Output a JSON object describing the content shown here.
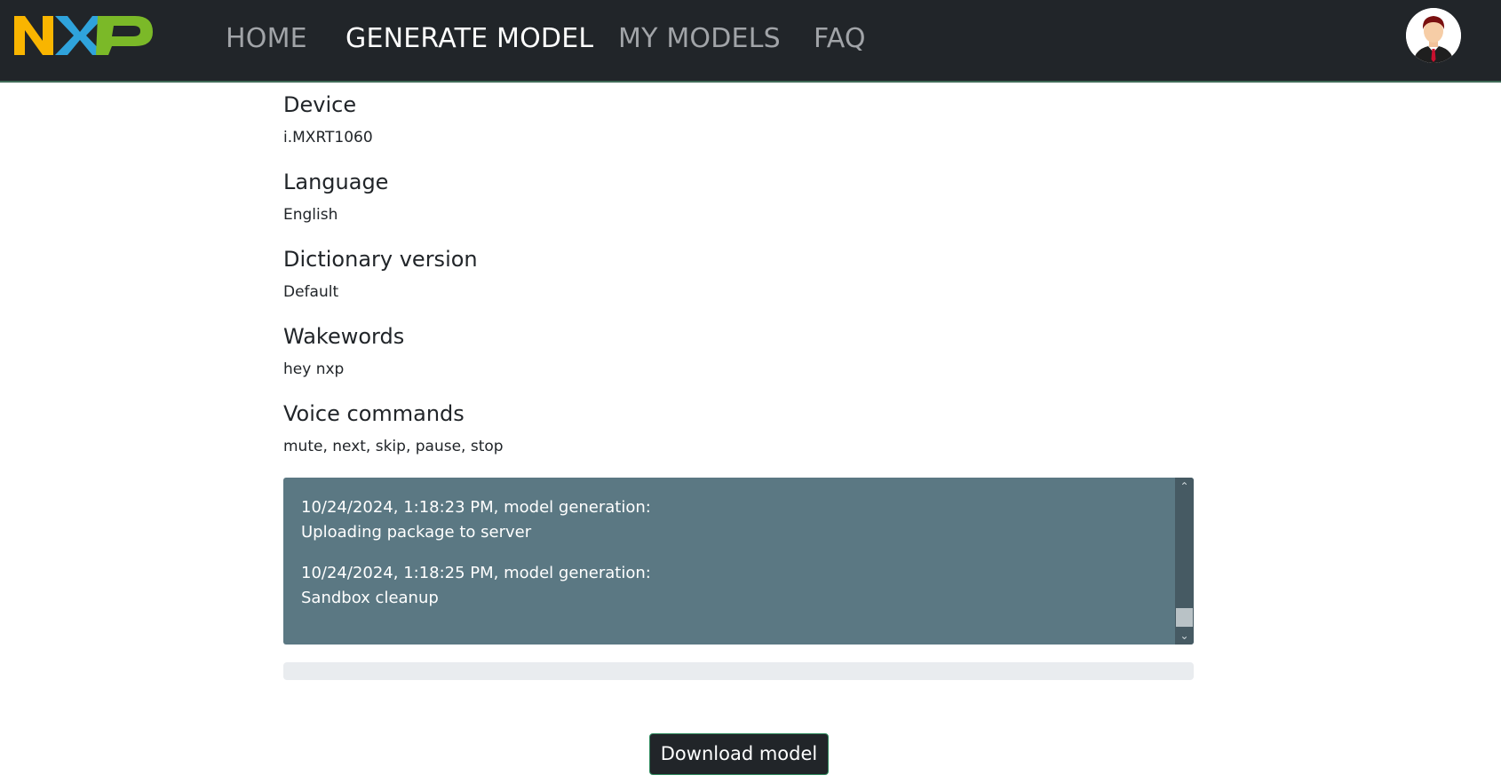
{
  "header": {
    "logo_text": "NXP",
    "nav": [
      {
        "label": "HOME"
      },
      {
        "label": "GENERATE MODEL"
      },
      {
        "label": "MY MODELS"
      },
      {
        "label": "FAQ"
      }
    ]
  },
  "fields": {
    "device": {
      "title": "Device",
      "value": "i.MXRT1060"
    },
    "language": {
      "title": "Language",
      "value": "English"
    },
    "dictionary": {
      "title": "Dictionary version",
      "value": "Default"
    },
    "wakewords": {
      "title": "Wakewords",
      "value": "hey nxp"
    },
    "voice_commands": {
      "title": "Voice commands",
      "value": "mute, next, skip, pause, stop"
    }
  },
  "log": {
    "entries": [
      {
        "timestamp": "10/24/2024, 1:18:23 PM, model generation:",
        "message": "Uploading package to server"
      },
      {
        "timestamp": "10/24/2024, 1:18:25 PM, model generation:",
        "message": "Sandbox cleanup"
      }
    ]
  },
  "progress": {
    "value": 0
  },
  "actions": {
    "download_label": "Download model"
  },
  "colors": {
    "navbar_bg": "#212529",
    "log_bg": "#5b7883",
    "logo_yellow": "#f9b500",
    "logo_blue": "#2fa3dc",
    "logo_green": "#7bb928"
  }
}
